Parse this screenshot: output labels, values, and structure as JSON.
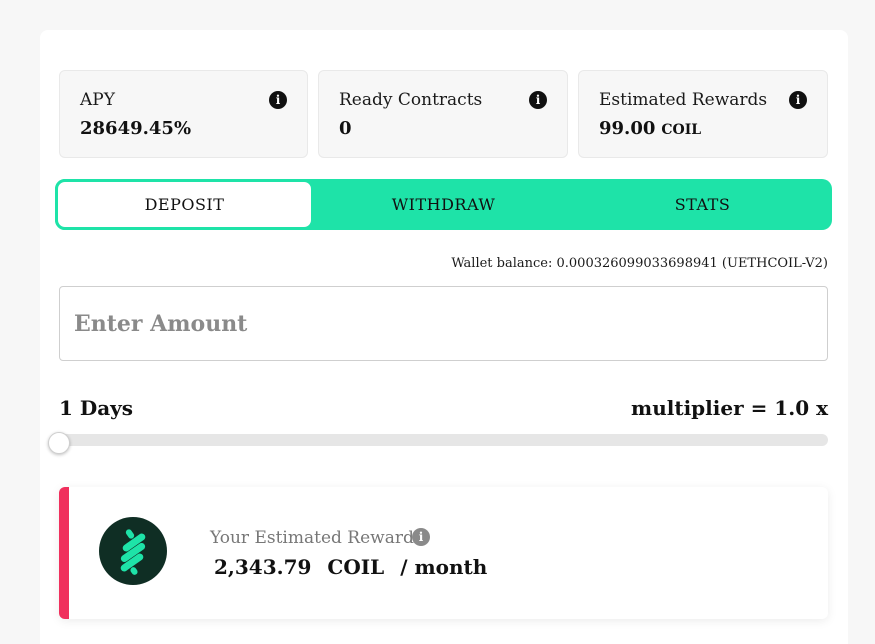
{
  "stats": [
    {
      "label": "APY",
      "value": "28649.45%",
      "unit": "",
      "icon": "info-icon"
    },
    {
      "label": "Ready Contracts",
      "value": "0",
      "unit": "",
      "icon": "info-icon"
    },
    {
      "label": "Estimated Rewards",
      "value": "99.00",
      "unit": "COIL",
      "icon": "info-icon"
    }
  ],
  "tabs": [
    {
      "label": "DEPOSIT",
      "active": true
    },
    {
      "label": "WITHDRAW",
      "active": false
    },
    {
      "label": "STATS",
      "active": false
    }
  ],
  "wallet": {
    "text": "Wallet balance: 0.000326099033698941 (UETHCOIL-V2)"
  },
  "amount": {
    "placeholder": "Enter Amount",
    "value": ""
  },
  "lock": {
    "days_label": "1 Days",
    "multiplier_label": "multiplier = 1.0 x",
    "slider_fraction": 0.0
  },
  "rewards": {
    "label": "Your Estimated Rewards",
    "amount": "2,343.79",
    "unit": "COIL",
    "period": "/ month",
    "logo": "coil-logo-icon"
  },
  "colors": {
    "accent": "#1ee3a8",
    "rewards_accent": "#f0305d",
    "logo_bg": "#0f2e24",
    "logo_fg": "#1ee3a8"
  }
}
